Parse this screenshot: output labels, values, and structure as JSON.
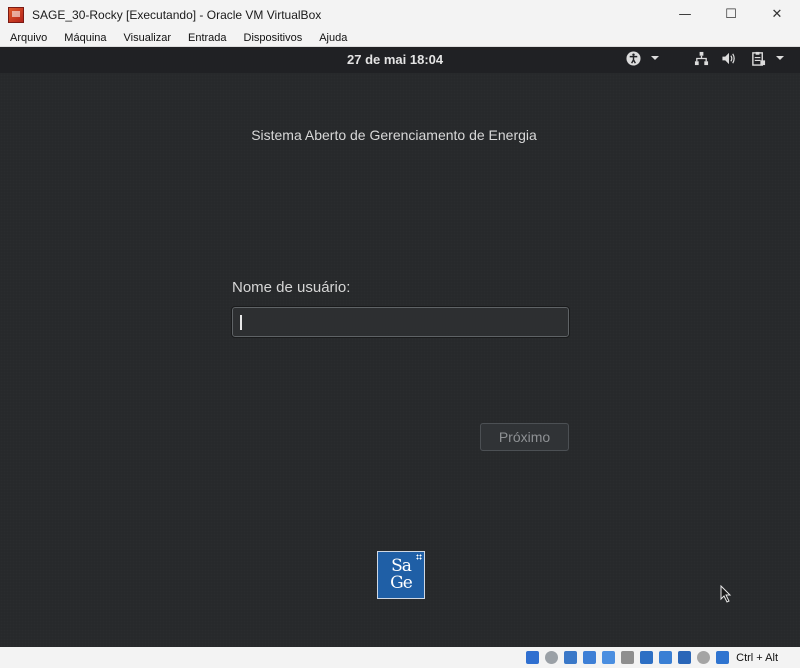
{
  "window": {
    "title": "SAGE_30-Rocky [Executando] - Oracle VM VirtualBox",
    "minimize_glyph": "—",
    "maximize_glyph": "☐",
    "close_glyph": "✕"
  },
  "menubar": {
    "items": [
      "Arquivo",
      "Máquina",
      "Visualizar",
      "Entrada",
      "Dispositivos",
      "Ajuda"
    ]
  },
  "guest": {
    "topbar": {
      "clock": "27 de mai  18:04",
      "icons": [
        "accessibility-icon",
        "network-icon",
        "volume-icon",
        "clipboard-icon"
      ]
    },
    "tagline": "Sistema Aberto de Gerenciamento de Energia",
    "login": {
      "username_label": "Nome de usuário:",
      "username_value": "",
      "next_button": "Próximo"
    },
    "logo": {
      "line1": "Sa",
      "line2": "Ge"
    }
  },
  "statusbar": {
    "icons": [
      "hard-disk-icon",
      "optical-drive-icon",
      "audio-icon",
      "network-adapter-icon",
      "usb-icon",
      "shared-folders-icon",
      "display-icon",
      "recording-icon",
      "virtualization-icon",
      "mouse-integration-icon",
      "keyboard-capture-icon"
    ],
    "host_key": "Ctrl + Alt"
  },
  "colors": {
    "guest_background": "#27292b",
    "topbar": "#202124",
    "logo_blue": "#1f5fa6"
  }
}
